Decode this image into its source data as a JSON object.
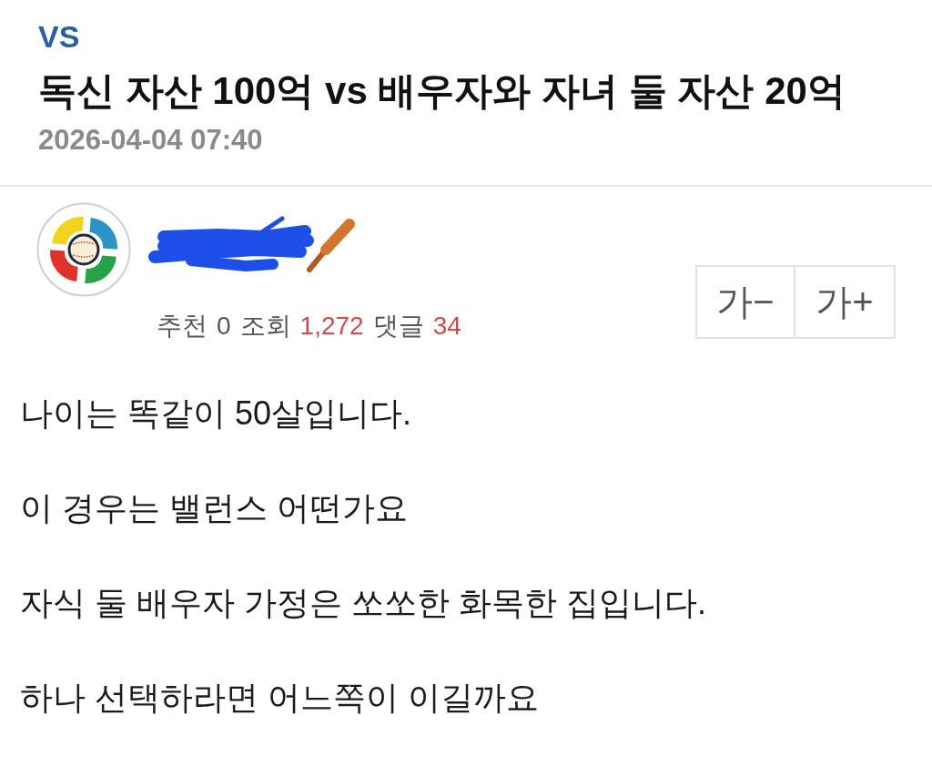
{
  "category": "VS",
  "title": "독신 자산 100억 vs 배우자와 자녀 둘 자산 20억",
  "date": "2026-04-04 07:40",
  "stats": [
    {
      "label": "추천",
      "value": "0",
      "highlight": false
    },
    {
      "label": "조회",
      "value": "1,272",
      "highlight": true
    },
    {
      "label": "댓글",
      "value": "34",
      "highlight": true
    }
  ],
  "font_size_buttons": [
    "가−",
    "가+"
  ],
  "body": [
    "나이는 똑같이 50살입니다.",
    "이 경우는 밸런스 어떤가요",
    "자식 둘 배우자 가정은 쏘쏘한 화목한 집입니다.",
    "하나 선택하라면 어느쪽이 이길까요"
  ]
}
